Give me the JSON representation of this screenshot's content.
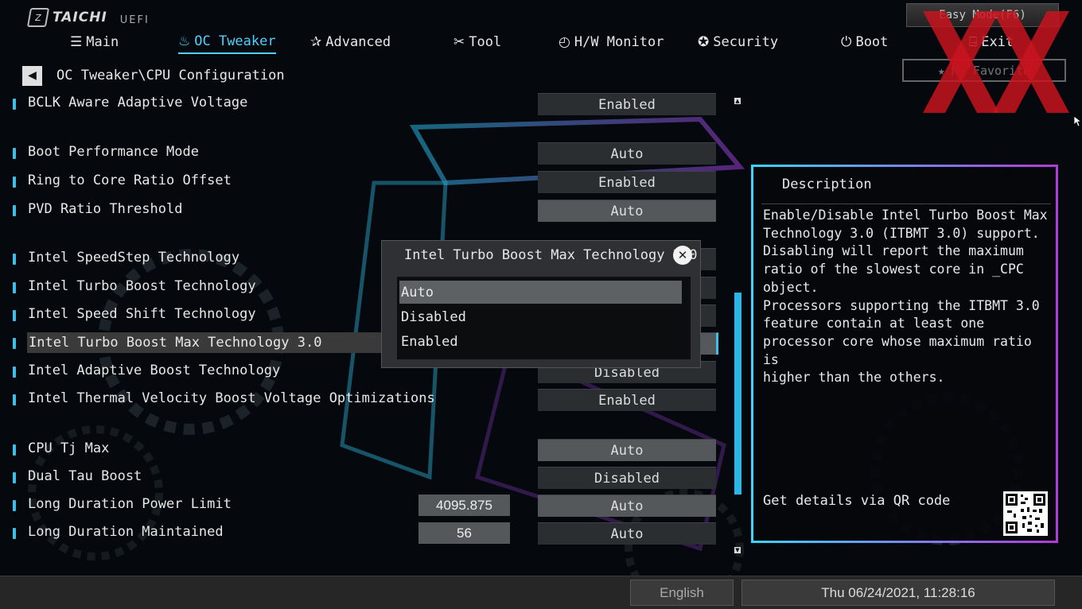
{
  "brand": {
    "logo_text": "TAICHI",
    "uefi_label": "UEFI"
  },
  "nav": [
    {
      "label": "Main",
      "icon": "menu-icon"
    },
    {
      "label": "OC Tweaker",
      "icon": "flame-icon"
    },
    {
      "label": "Advanced",
      "icon": "star-icon"
    },
    {
      "label": "Tool",
      "icon": "tools-icon"
    },
    {
      "label": "H/W Monitor",
      "icon": "gauge-icon"
    },
    {
      "label": "Security",
      "icon": "shield-icon"
    },
    {
      "label": "Boot",
      "icon": "power-icon"
    },
    {
      "label": "Exit",
      "icon": "exit-icon"
    }
  ],
  "easy_mode_label": "Easy Mode(F6)",
  "favorite_label": "My Favorite",
  "breadcrumb": "OC Tweaker\\CPU Configuration",
  "settings": [
    {
      "label": "BCLK Aware Adaptive Voltage",
      "value": "Enabled"
    },
    {
      "label": "Boot Performance Mode",
      "value": "Auto"
    },
    {
      "label": "Ring to Core Ratio Offset",
      "value": "Enabled"
    },
    {
      "label": "PVD Ratio Threshold",
      "value": "Auto"
    },
    {
      "label": "Intel SpeedStep Technology",
      "value": ""
    },
    {
      "label": "Intel Turbo Boost Technology",
      "value": ""
    },
    {
      "label": "Intel Speed Shift Technology",
      "value": ""
    },
    {
      "label": "Intel Turbo Boost Max Technology 3.0",
      "value": ""
    },
    {
      "label": "Intel Adaptive Boost Technology",
      "value": "Disabled"
    },
    {
      "label": "Intel Thermal Velocity Boost Voltage Optimizations",
      "value": "Enabled"
    },
    {
      "label": "CPU Tj Max",
      "value": "Auto"
    },
    {
      "label": "Dual Tau Boost",
      "value": "Disabled"
    },
    {
      "label": "Long Duration Power Limit",
      "value": "Auto",
      "number": "4095.875"
    },
    {
      "label": "Long Duration Maintained",
      "value": "Auto",
      "number": "56"
    }
  ],
  "popup": {
    "title": "Intel Turbo Boost Max Technology 3.0",
    "options": [
      "Auto",
      "Disabled",
      "Enabled"
    ],
    "selected": "Auto"
  },
  "description": {
    "title": "Description",
    "body": "Enable/Disable Intel Turbo Boost Max\nTechnology 3.0 (ITBMT 3.0) support.\nDisabling will report the maximum\nratio of the slowest core in _CPC\nobject.\nProcessors supporting the ITBMT 3.0\nfeature contain at least one\nprocessor core whose maximum ratio is\nhigher than the others.",
    "qr_text": "Get details via QR code"
  },
  "status": {
    "language": "English",
    "datetime": "Thu 06/24/2021, 11:28:16"
  },
  "colors": {
    "accent": "#4fd0ff",
    "panel_border_start": "#3bd5ff",
    "panel_border_end": "#b03bd8",
    "watermark": "#c8141e"
  }
}
